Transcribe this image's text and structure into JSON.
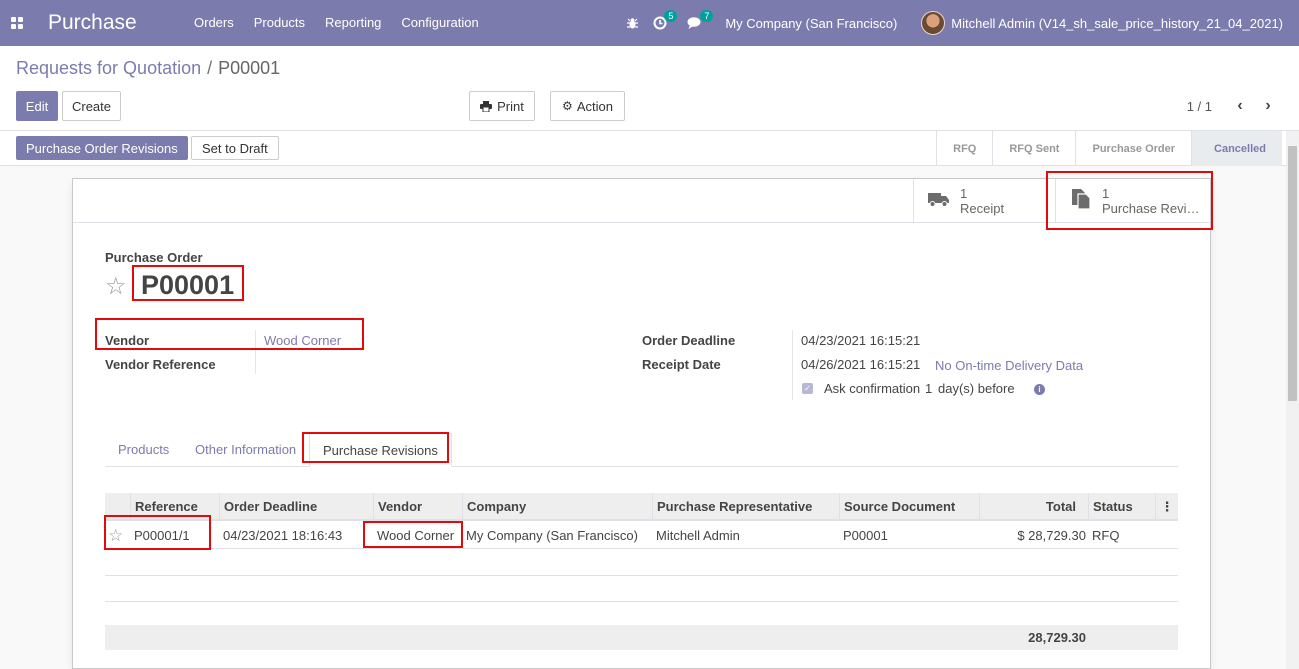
{
  "navbar": {
    "app_name": "Purchase",
    "menu": [
      "Orders",
      "Products",
      "Reporting",
      "Configuration"
    ],
    "activity_count": "5",
    "message_count": "7",
    "company": "My Company (San Francisco)",
    "user": "Mitchell Admin (V14_sh_sale_price_history_21_04_2021)"
  },
  "breadcrumb": {
    "parent": "Requests for Quotation",
    "current": "P00001"
  },
  "toolbar": {
    "edit_label": "Edit",
    "create_label": "Create",
    "print_label": "Print",
    "action_label": "Action",
    "pager": "1 / 1"
  },
  "statusbar": {
    "revisions_button": "Purchase Order Revisions",
    "draft_button": "Set to Draft",
    "stages": [
      "RFQ",
      "RFQ Sent",
      "Purchase Order",
      "Cancelled"
    ],
    "active_stage": "Cancelled"
  },
  "smart_buttons": [
    {
      "count": "1",
      "label": "Receipt",
      "icon": "truck-icon"
    },
    {
      "count": "1",
      "label": "Purchase Revi…",
      "icon": "copy-icon"
    }
  ],
  "form": {
    "title_label": "Purchase Order",
    "name": "P00001",
    "vendor_label": "Vendor",
    "vendor_value": "Wood Corner",
    "vendor_ref_label": "Vendor Reference",
    "vendor_ref_value": "",
    "order_deadline_label": "Order Deadline",
    "order_deadline_value": "04/23/2021 16:15:21",
    "receipt_date_label": "Receipt Date",
    "receipt_date_value": "04/26/2021 16:15:21",
    "on_time_text": "No On-time Delivery Data",
    "ask_confirmation_label": "Ask confirmation",
    "ask_confirmation_days": "1",
    "ask_confirmation_suffix": "day(s) before",
    "ask_confirmation_checked": true
  },
  "tabs": [
    "Products",
    "Other Information",
    "Purchase Revisions"
  ],
  "active_tab": "Purchase Revisions",
  "revisions_table": {
    "columns": [
      "Reference",
      "Order Deadline",
      "Vendor",
      "Company",
      "Purchase Representative",
      "Source Document",
      "Total",
      "Status"
    ],
    "rows": [
      {
        "reference": "P00001/1",
        "order_deadline": "04/23/2021 18:16:43",
        "vendor": "Wood Corner",
        "company": "My Company (San Francisco)",
        "representative": "Mitchell Admin",
        "source_document": "P00001",
        "total": "$ 28,729.30",
        "status": "RFQ"
      }
    ],
    "footer_total": "28,729.30"
  },
  "colors": {
    "brand": "#7c7bad",
    "annotation": "#e20a0a"
  }
}
